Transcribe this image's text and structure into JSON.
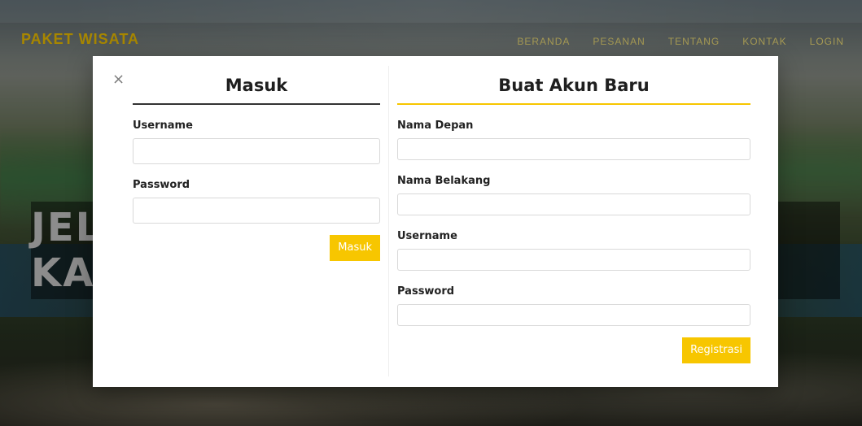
{
  "header": {
    "brand": "PAKET WISATA",
    "nav": [
      "BERANDA",
      "PESANAN",
      "TENTANG",
      "KONTAK",
      "LOGIN"
    ]
  },
  "hero": {
    "text": "JELAJAHI INDONESIA BERSAMA KAMI"
  },
  "modal": {
    "close_symbol": "×",
    "login": {
      "title": "Masuk",
      "username_label": "Username",
      "password_label": "Password",
      "submit_label": "Masuk"
    },
    "register": {
      "title": "Buat Akun Baru",
      "first_name_label": "Nama Depan",
      "last_name_label": "Nama Belakang",
      "username_label": "Username",
      "password_label": "Password",
      "submit_label": "Registrasi"
    }
  },
  "colors": {
    "accent": "#f7c600",
    "title_text": "#1f1f1f"
  }
}
